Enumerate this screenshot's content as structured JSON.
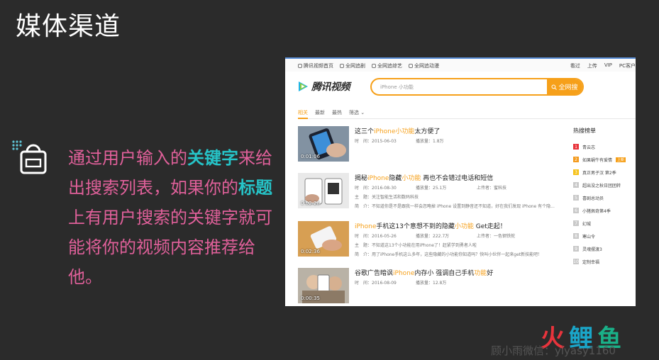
{
  "slide": {
    "title": "媒体渠道",
    "bullet": {
      "p1": "通过用户输入的",
      "k1": "关键字",
      "p2": "来给出搜索列表，如果你的",
      "k2": "标题",
      "p3": "上有用户搜索的关键字就可能将你的视频内容推荐给他。"
    }
  },
  "site": {
    "top_left": [
      "腾讯视频首页",
      "全网追剧",
      "全网追综艺",
      "全网追动漫"
    ],
    "top_right": [
      "看过",
      "上传",
      "VIP",
      "PC客户"
    ],
    "logo": "腾讯视频",
    "search_value": "iPhone 小功能",
    "search_button": "全网搜",
    "tabs": [
      "相关",
      "最新",
      "最热",
      "筛选"
    ]
  },
  "results": [
    {
      "duration": "0:01:06",
      "title_pre": "这三个",
      "title_hl1": "iPhone",
      "title_hl2": "小功能",
      "title_post": "太方便了",
      "time": "时　间：2015-06-03",
      "plays": "播放量：1.8万",
      "uploader": "",
      "topic": "",
      "intro": ""
    },
    {
      "duration": "0:02:28",
      "title_pre": "揭秘",
      "title_hl1": "iPhone",
      "title_mid": "隐藏",
      "title_hl2": "小功能",
      "title_post": " 再也不会错过电话和短信",
      "time": "时　间：2016-08-30",
      "plays": "播放量：25.1万",
      "uploader": "上传者：蜜科技",
      "topic": "主　题：关注智能生活和数码科技",
      "intro": "简　介：不知道你是不是跟我一样会忽略掉 iPhone 设置到静音还不知道，好在我们发现 iPhone 有个隐..."
    },
    {
      "duration": "0:02:36",
      "title_hl1": "iPhone",
      "title_pre2": "手机这13个意想不到的隐藏",
      "title_hl2": "小功能",
      "title_post": " Get走起！",
      "time": "时　间：2016-05-26",
      "plays": "播放量：222.7万",
      "uploader": "上传者：一色钢铁舵",
      "topic": "主　题：不知道这13个小功能在用iPhone了！赶紧学到勇者人啦",
      "intro": "简　介：用了iPhone手机这么多年，这些隐藏的小功能你知道吗？快叫小伙伴一起来get新技能吧！"
    },
    {
      "duration": "0:00:35",
      "title_pre": "谷歌广告暗讽",
      "title_hl1": "iPhone",
      "title_mid": "内存小",
      "title_post": " 强调自己手机",
      "title_hl2": "功能",
      "title_post2": "好",
      "time": "时　间：2016-08-09",
      "plays": "播放量：12.8万",
      "uploader": "",
      "topic": "",
      "intro": ""
    }
  ],
  "hot": {
    "header": "热搜榜单",
    "items": [
      "青云志",
      "如果蜗牛有爱情",
      "真正男子汉 第2季",
      "超出没之秋日团团转",
      "喜剧总动员",
      "小猪佩奇第4季",
      "幻城",
      "寒山令",
      "灵魂摆渡3",
      "定制幸福"
    ],
    "new_tag": "上新"
  },
  "footer": {
    "watermark": "顾小雨微信：yiyasy1160",
    "brand": [
      "火",
      "鲤",
      "鱼"
    ]
  },
  "colors": {
    "accent": "#f6a01a",
    "pink": "#e0609a",
    "cyan": "#26c4c8"
  }
}
